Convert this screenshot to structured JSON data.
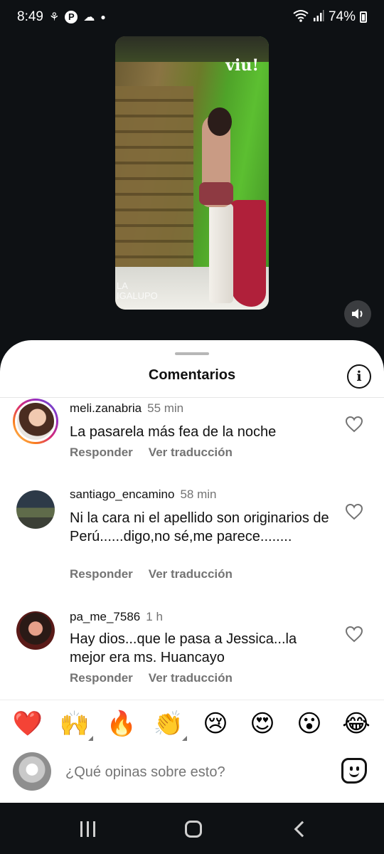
{
  "status_bar": {
    "time": "8:49",
    "battery": "74%",
    "icons": [
      "wind-sail-icon",
      "pinterest-icon",
      "cloud-icon",
      "dot-icon",
      "wifi-icon",
      "signal-icon",
      "battery-icon"
    ]
  },
  "video": {
    "brand_logo": "viu!",
    "watermark_line1": "LA",
    "watermark_line2": "IGALUPO",
    "volume_icon": "speaker-icon"
  },
  "sheet": {
    "title": "Comentarios",
    "info_icon": "i"
  },
  "comments": [
    {
      "username": "meli.zanabria",
      "time": "55 min",
      "text": "La pasarela más fea de la noche",
      "reply_label": "Responder",
      "translate_label": "Ver traducción"
    },
    {
      "username": "santiago_encamino",
      "time": "58 min",
      "text": "Ni la cara ni el apellido son originarios de Perú......digo,no sé,me parece........",
      "reply_label": "Responder",
      "translate_label": "Ver traducción"
    },
    {
      "username": "pa_me_7586",
      "time": "1 h",
      "text": "Hay dios...que le pasa a Jessica...la mejor era ms. Huancayo",
      "reply_label": "Responder",
      "translate_label": "Ver traducción"
    }
  ],
  "emoji_bar": [
    "❤️",
    "🙌",
    "🔥",
    "👏",
    "😢",
    "😍",
    "😮",
    "😂"
  ],
  "composer": {
    "placeholder": "¿Qué opinas sobre esto?"
  },
  "colors": {
    "accent_text_muted": "#737373",
    "sheet_bg": "#ffffff",
    "screen_bg": "#0e1114"
  }
}
